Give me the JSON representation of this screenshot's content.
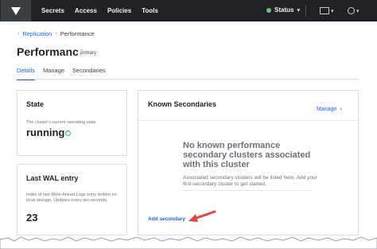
{
  "nav": {
    "items": [
      "Secrets",
      "Access",
      "Policies",
      "Tools"
    ],
    "status_label": "Status"
  },
  "breadcrumb": {
    "parent": "Replication",
    "current": "Performance"
  },
  "page": {
    "title": "Performance",
    "badge": "primary"
  },
  "tabs": [
    "Details",
    "Manage",
    "Secondaries"
  ],
  "state_card": {
    "title": "State",
    "description": "The cluster's current operating state.",
    "value": "running"
  },
  "wal_card": {
    "title": "Last WAL entry",
    "description": "Index of last Write Ahead Logs entry written on local storage. Updates every ten seconds.",
    "value": "23"
  },
  "secondaries_card": {
    "title": "Known Secondaries",
    "manage_label": "Manage",
    "empty_title": "No known performance secondary clusters associated with this cluster",
    "empty_description": "Associated secondary clusters will be listed here. Add your first secondary cluster to get started.",
    "add_label": "Add secondary"
  },
  "colors": {
    "accent": "#1563ff",
    "topbar": "#1f2124",
    "status_ok": "#5fca7a",
    "arrow": "#e0463b"
  }
}
